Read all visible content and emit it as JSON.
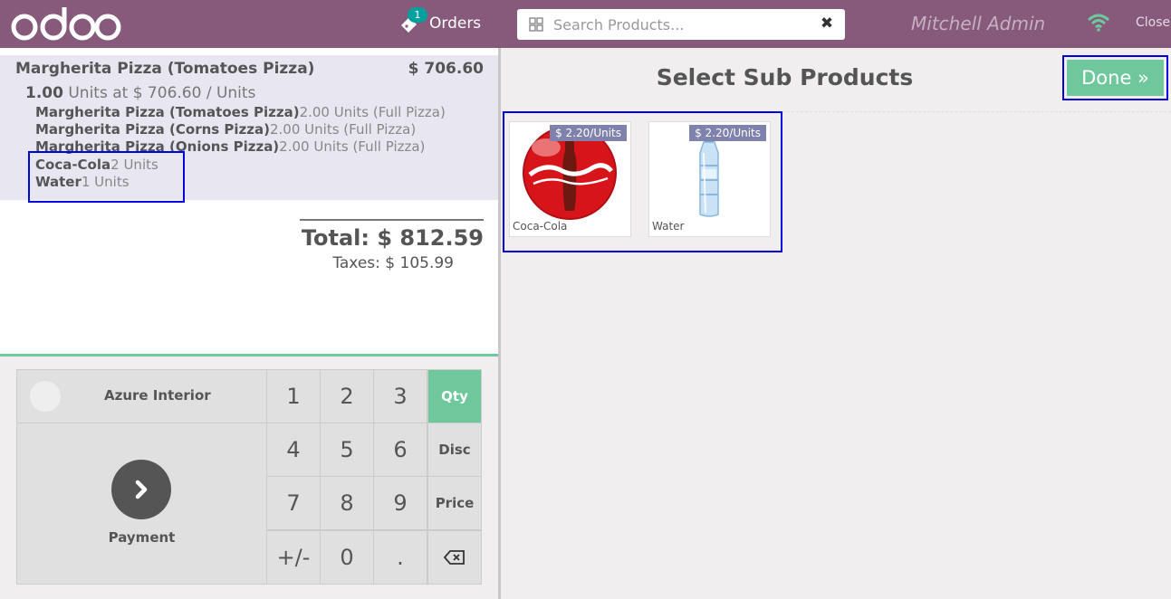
{
  "header": {
    "orders_label": "Orders",
    "orders_count": "1",
    "search_placeholder": "Search Products...",
    "cashier": "Mitchell Admin",
    "close_label": "Close"
  },
  "order": {
    "line": {
      "name": "Margherita Pizza (Tomatoes Pizza)",
      "price": "$ 706.60",
      "qty": "1.00",
      "unit_info": "Units at $ 706.60 / Units",
      "sub_items": [
        {
          "name": "Margherita Pizza (Tomatoes Pizza)",
          "qty": "2.00 Units (Full Pizza)"
        },
        {
          "name": "Margherita Pizza (Corns Pizza)",
          "qty": "2.00 Units (Full Pizza)"
        },
        {
          "name": "Margherita Pizza (Onions Pizza)",
          "qty": "2.00 Units (Full Pizza)"
        },
        {
          "name": "Coca-Cola",
          "qty": "2 Units"
        },
        {
          "name": "Water",
          "qty": "1 Units"
        }
      ]
    },
    "total": "Total: $ 812.59",
    "taxes": "Taxes: $ 105.99"
  },
  "controls": {
    "customer": "Azure Interior",
    "payment": "Payment",
    "keys": [
      "1",
      "2",
      "3",
      "Qty",
      "4",
      "5",
      "6",
      "Disc",
      "7",
      "8",
      "9",
      "Price",
      "+/-",
      "0",
      "."
    ],
    "active_mode": "Qty"
  },
  "sub_products": {
    "title": "Select Sub Products",
    "done_label": "Done »",
    "items": [
      {
        "name": "Coca-Cola",
        "price": "$ 2.20/Units"
      },
      {
        "name": "Water",
        "price": "$ 2.20/Units"
      }
    ]
  },
  "colors": {
    "header": "#875a7b",
    "accent": "#6ec89b",
    "highlight": "#0000e0"
  }
}
